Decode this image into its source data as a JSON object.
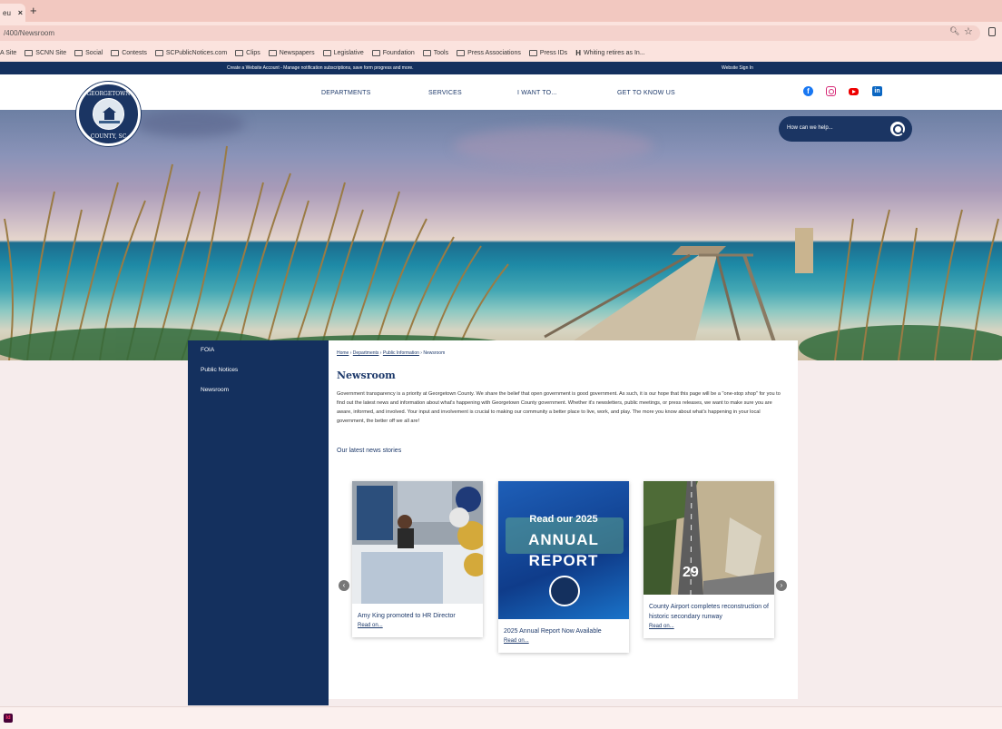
{
  "browser": {
    "tab_label": "eu",
    "tab_close": "×",
    "new_tab": "+",
    "url": "/400/Newsroom",
    "bookmarks": [
      "A Site",
      "SCNN Site",
      "Social",
      "Contests",
      "SCPublicNotices.com",
      "Clips",
      "Newspapers",
      "Legislative",
      "Foundation",
      "Tools",
      "Press Associations",
      "Press IDs",
      "Whiting retires as In..."
    ]
  },
  "site": {
    "notice": "Create a Website Account - Manage notification subscriptions, save form progress and more.",
    "signin": "Website Sign In",
    "seal_top": "GEORGETOWN",
    "seal_bottom": "COUNTY, SC",
    "nav": [
      "DEPARTMENTS",
      "SERVICES",
      "I WANT TO...",
      "GET TO KNOW US"
    ],
    "search_placeholder": "How can we help..."
  },
  "sidebar": {
    "items": [
      "FOIA",
      "Public Notices",
      "Newsroom"
    ]
  },
  "content": {
    "breadcrumb": [
      "Home",
      "Departments",
      "Public Information",
      "Newsroom"
    ],
    "title": "Newsroom",
    "intro": "Government transparency is a priority at Georgetown County.  We share the belief that open government is good government.  As such, it is our hope that this page will be a \"one-stop shop\" for you to find out the latest news and information about what's happening with Georgetown County government.  Whether it's newsletters, public meetings, or press releases, we want to make sure you are aware, informed, and involved.  Your input and involvement is crucial to making our community a better place to live, work, and play.  The more you know about what's happening in your local government, the better off we all are!",
    "latest_heading": "Our latest news stories",
    "cards": [
      {
        "title": "Amy King promoted to HR Director",
        "link": "Read on..."
      },
      {
        "title": "2025 Annual Report Now Available",
        "link": "Read on...",
        "img_line1": "Read our 2025",
        "img_line2": "ANNUAL",
        "img_line3": "REPORT"
      },
      {
        "title": "County Airport completes reconstruction of historic secondary runway",
        "link": "Read on...",
        "runway_number": "29"
      }
    ]
  },
  "taskbar": {
    "app_label": "Id"
  }
}
